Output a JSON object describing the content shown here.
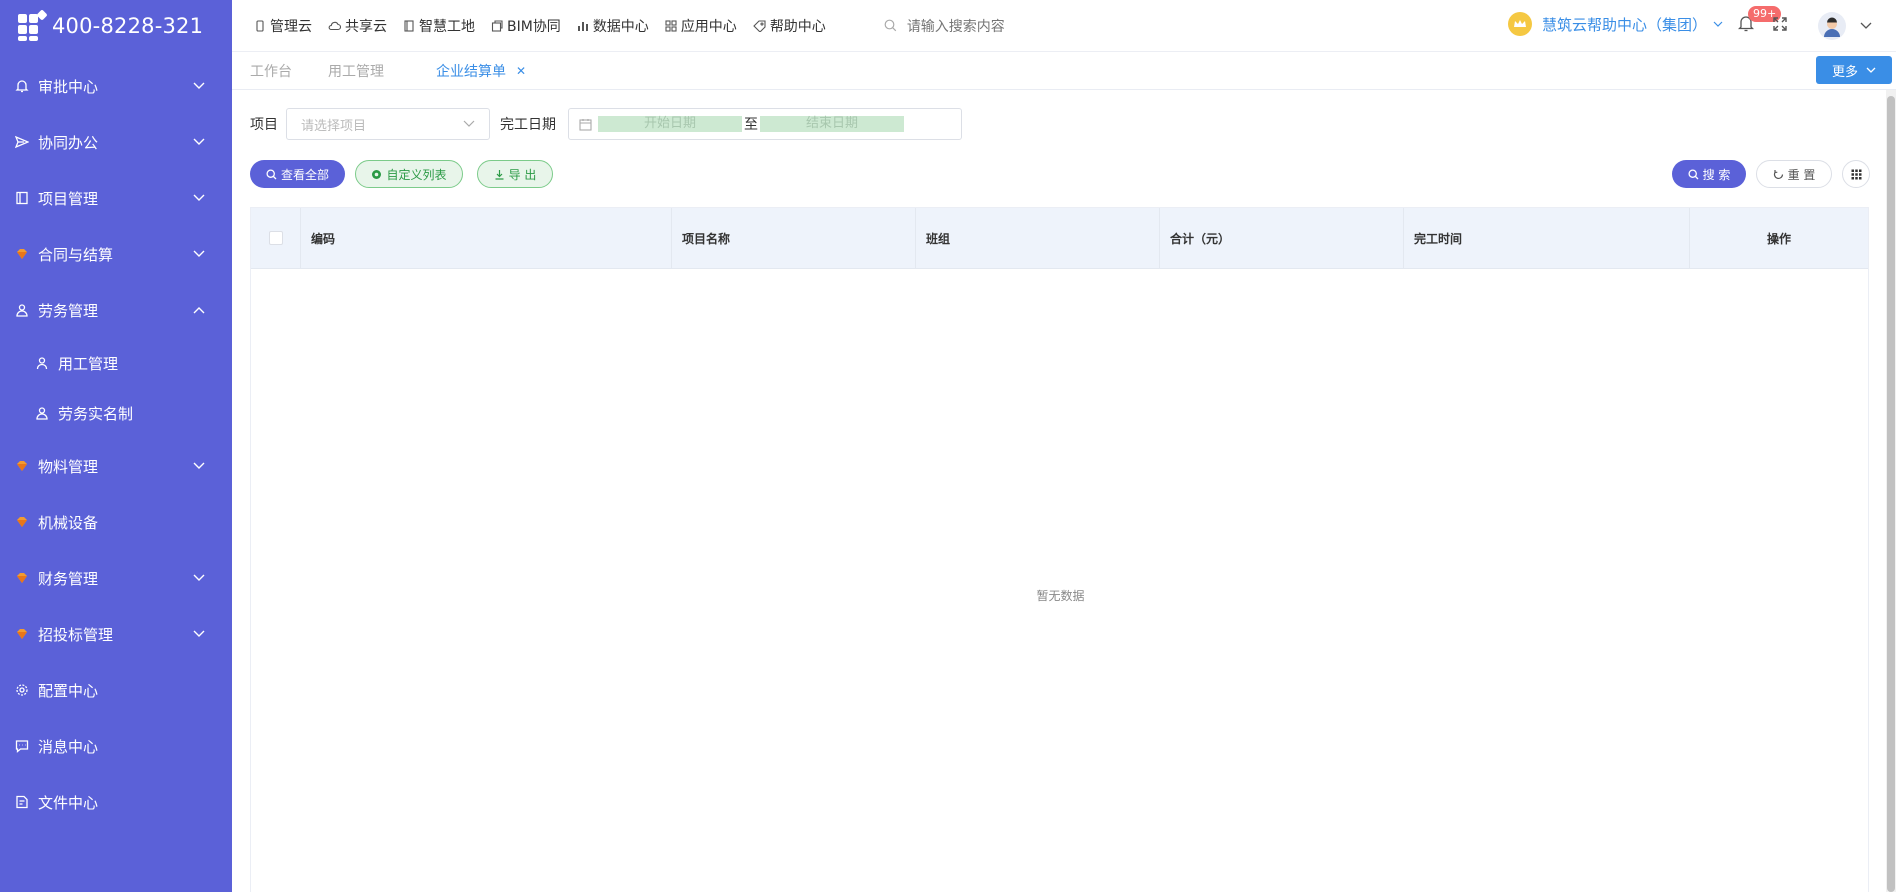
{
  "brand": {
    "phone": "400-8228-321"
  },
  "sidebar": {
    "items": [
      {
        "label": "审批中心",
        "icon": "bell-icon",
        "expanded": false,
        "has_children": true
      },
      {
        "label": "协同办公",
        "icon": "send-icon",
        "expanded": false,
        "has_children": true
      },
      {
        "label": "项目管理",
        "icon": "book-icon",
        "expanded": false,
        "has_children": true
      },
      {
        "label": "合同与结算",
        "icon": "gem-icon",
        "expanded": false,
        "has_children": true
      },
      {
        "label": "劳务管理",
        "icon": "worker-icon",
        "expanded": true,
        "has_children": true
      },
      {
        "label": "物料管理",
        "icon": "gem-icon",
        "expanded": false,
        "has_children": true
      },
      {
        "label": "机械设备",
        "icon": "gem-icon",
        "expanded": false,
        "has_children": false
      },
      {
        "label": "财务管理",
        "icon": "gem-icon",
        "expanded": false,
        "has_children": true
      },
      {
        "label": "招投标管理",
        "icon": "gem-icon",
        "expanded": false,
        "has_children": true
      },
      {
        "label": "配置中心",
        "icon": "gear-icon",
        "expanded": false,
        "has_children": false
      },
      {
        "label": "消息中心",
        "icon": "chat-icon",
        "expanded": false,
        "has_children": false
      },
      {
        "label": "文件中心",
        "icon": "file-icon",
        "expanded": false,
        "has_children": false
      }
    ],
    "labor_children": [
      {
        "label": "用工管理",
        "icon": "person-icon"
      },
      {
        "label": "劳务实名制",
        "icon": "worker-icon"
      }
    ]
  },
  "topnav": {
    "items": [
      {
        "label": "管理云",
        "icon": "phone-icon"
      },
      {
        "label": "共享云",
        "icon": "cloud-icon"
      },
      {
        "label": "智慧工地",
        "icon": "book-icon"
      },
      {
        "label": "BIM协同",
        "icon": "box-icon"
      },
      {
        "label": "数据中心",
        "icon": "bar-chart-icon"
      },
      {
        "label": "应用中心",
        "icon": "grid-icon"
      },
      {
        "label": "帮助中心",
        "icon": "tag-icon"
      }
    ],
    "search_placeholder": "请输入搜索内容",
    "org_name": "慧筑云帮助中心（集团）",
    "notification_count": "99+"
  },
  "tabs": {
    "items": [
      {
        "label": "工作台",
        "active": false
      },
      {
        "label": "用工管理",
        "active": false
      },
      {
        "label": "企业结算单",
        "active": true,
        "closable": true
      }
    ],
    "more_label": "更多"
  },
  "filters": {
    "project_label": "项目",
    "project_placeholder": "请选择项目",
    "date_label": "完工日期",
    "start_placeholder": "开始日期",
    "range_sep": "至",
    "end_placeholder": "结束日期"
  },
  "actions": {
    "view_all": "查看全部",
    "custom_list": "自定义列表",
    "export": "导 出",
    "search": "搜 索",
    "reset": "重 置"
  },
  "table": {
    "columns": [
      "编码",
      "项目名称",
      "班组",
      "合计（元）",
      "完工时间",
      "操作"
    ],
    "empty_text": "暂无数据"
  },
  "colors": {
    "sidebar_bg": "#5b61d8",
    "primary": "#5b61d8",
    "link_blue": "#3a8ee6",
    "green": "#2b9a45"
  }
}
